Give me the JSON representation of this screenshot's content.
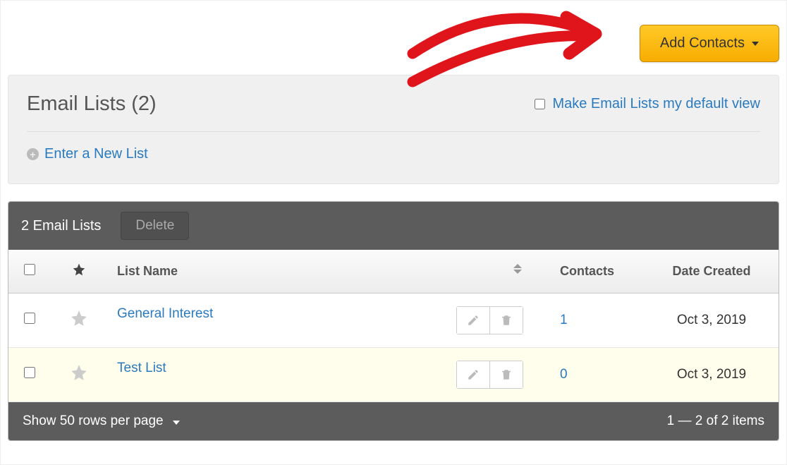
{
  "header": {
    "add_contacts_label": "Add Contacts"
  },
  "panel": {
    "title": "Email Lists (2)",
    "default_view_label": "Make Email Lists my default view",
    "new_list_label": "Enter a New List"
  },
  "toolbar": {
    "count_label": "2 Email Lists",
    "delete_label": "Delete"
  },
  "table": {
    "columns": {
      "name": "List Name",
      "contacts": "Contacts",
      "date": "Date Created"
    },
    "rows": [
      {
        "name": "General Interest",
        "contacts": "1",
        "date": "Oct 3, 2019"
      },
      {
        "name": "Test List",
        "contacts": "0",
        "date": "Oct 3, 2019"
      }
    ]
  },
  "footer": {
    "pager_label": "Show 50 rows per page",
    "summary": "1 — 2 of 2 items"
  }
}
